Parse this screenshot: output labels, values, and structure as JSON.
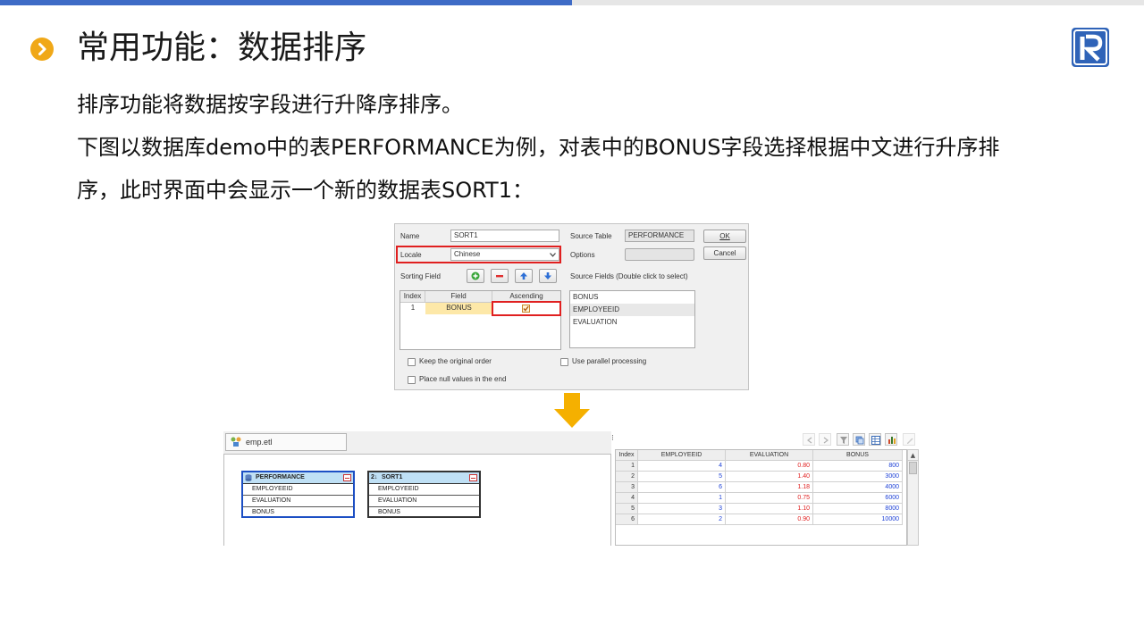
{
  "title": "常用功能：数据排序",
  "paragraphs": [
    "排序功能将数据按字段进行升降序排序。",
    "下图以数据库demo中的表PERFORMANCE为例，对表中的BONUS字段选择根据中文进行升序排",
    "序，此时界面中会显示一个新的数据表SORT1："
  ],
  "colors": {
    "accent": "#3e6bc6",
    "bullet": "#f0a818",
    "highlight": "#e02020",
    "arrow": "#f5b000"
  },
  "dialog": {
    "name_label": "Name",
    "name_value": "SORT1",
    "source_table_label": "Source Table",
    "source_table_value": "PERFORMANCE",
    "ok_label": "OK",
    "cancel_label": "Cancel",
    "locale_label": "Locale",
    "locale_value": "Chinese",
    "options_label": "Options",
    "sorting_field_label": "Sorting Field",
    "source_fields_label": "Source Fields (Double click to select)",
    "table_headers": [
      "Index",
      "Field",
      "Ascending"
    ],
    "sort_rows": [
      {
        "index": "1",
        "field": "BONUS",
        "ascending": true
      }
    ],
    "source_fields": [
      "BONUS",
      "EMPLOYEEID",
      "EVALUATION"
    ],
    "keep_original_order": "Keep the original order",
    "use_parallel": "Use parallel processing",
    "place_null_end": "Place null values in the end"
  },
  "editor": {
    "tab_label": "emp.etl",
    "nodes": [
      {
        "name": "PERFORMANCE",
        "fields": [
          "EMPLOYEEID",
          "EVALUATION",
          "BONUS"
        ]
      },
      {
        "name": "SORT1",
        "fields": [
          "EMPLOYEEID",
          "EVALUATION",
          "BONUS"
        ]
      }
    ]
  },
  "grid": {
    "headers": [
      "Index",
      "EMPLOYEEID",
      "EVALUATION",
      "BONUS"
    ],
    "rows": [
      [
        "1",
        "4",
        "0.80",
        "800"
      ],
      [
        "2",
        "5",
        "1.40",
        "3000"
      ],
      [
        "3",
        "6",
        "1.18",
        "4000"
      ],
      [
        "4",
        "1",
        "0.75",
        "6000"
      ],
      [
        "5",
        "3",
        "1.10",
        "8000"
      ],
      [
        "6",
        "2",
        "0.90",
        "10000"
      ]
    ]
  }
}
